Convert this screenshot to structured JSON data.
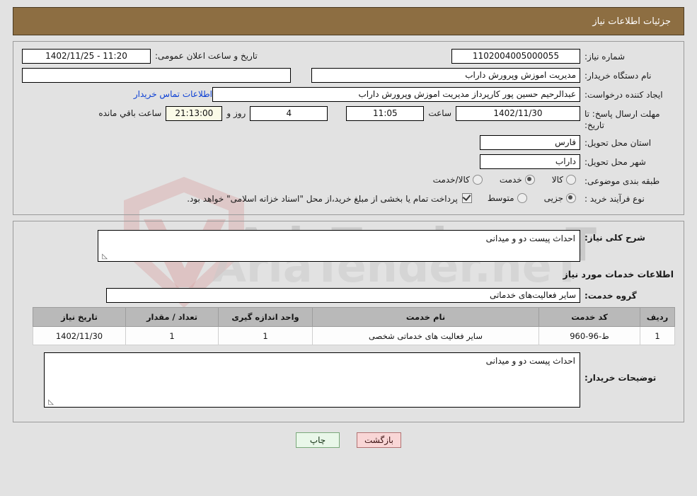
{
  "header": {
    "title": "جزئیات اطلاعات نیاز"
  },
  "form": {
    "need_number_label": "شماره نیاز:",
    "need_number_value": "1102004005000055",
    "public_announce_label": "تاریخ و ساعت اعلان عمومی:",
    "public_announce_value": "11:20 - 1402/11/25",
    "buyer_org_label": "نام دستگاه خریدار:",
    "buyer_org_value": "مدیریت اموزش وپرورش داراب",
    "buyer_org_extra": "",
    "creator_label": "ایجاد کننده درخواست:",
    "creator_value": "عبدالرحیم حسین پور کارپرداز مدیریت اموزش وپرورش داراب",
    "contact_link": "اطلاعات تماس خریدار",
    "deadline_label": "مهلت ارسال پاسخ: تا تاریخ:",
    "deadline_date": "1402/11/30",
    "time_label": "ساعت",
    "time_value": "11:05",
    "days_value": "4",
    "days_label": "روز و",
    "countdown_value": "21:13:00",
    "countdown_label": "ساعت باقي مانده",
    "province_label": "استان محل تحویل:",
    "province_value": "فارس",
    "city_label": "شهر محل تحویل:",
    "city_value": "داراب",
    "category_label": "طبقه بندی موضوعی:",
    "category_options": [
      {
        "label": "کالا",
        "selected": false
      },
      {
        "label": "خدمت",
        "selected": true
      },
      {
        "label": "کالا/خدمت",
        "selected": false
      }
    ],
    "process_label": "نوع فرآیند خرید :",
    "process_options": [
      {
        "label": "جزیی",
        "selected": true
      },
      {
        "label": "متوسط",
        "selected": false
      }
    ],
    "treasury_checked": true,
    "treasury_note": "پرداخت تمام یا بخشی از مبلغ خرید،از محل \"اسناد خزانه اسلامی\" خواهد بود."
  },
  "details": {
    "general_desc_label": "شرح کلی نیاز:",
    "general_desc_value": "احداث پیست دو و میدانی",
    "services_section_title": "اطلاعات خدمات مورد نیاز",
    "service_group_label": "گروه خدمت:",
    "service_group_value": "سایر فعالیت‌های خدماتی",
    "buyer_notes_label": "توضیحات خریدار:",
    "buyer_notes_value": "احداث پیست دو و میدانی"
  },
  "table": {
    "columns": [
      "ردیف",
      "کد خدمت",
      "نام خدمت",
      "واحد اندازه گیری",
      "تعداد / مقدار",
      "تاریخ نیاز"
    ],
    "rows": [
      {
        "row": "1",
        "code": "ط-96-960",
        "name": "سایر فعالیت های خدماتی شخصی",
        "unit": "1",
        "qty": "1",
        "date": "1402/11/30"
      }
    ]
  },
  "buttons": {
    "print": "چاپ",
    "back": "بازگشت"
  },
  "watermark": {
    "brand": "AriaTender.neT"
  },
  "colors": {
    "header_bg": "#8d6e42",
    "page_bg": "#e2e2e2",
    "link": "#0b3fd4",
    "table_header": "#b9b9b9",
    "print_btn": "#e9f7e9",
    "back_btn": "#f9d6d6",
    "countdown_bg": "#fbfbe8"
  }
}
